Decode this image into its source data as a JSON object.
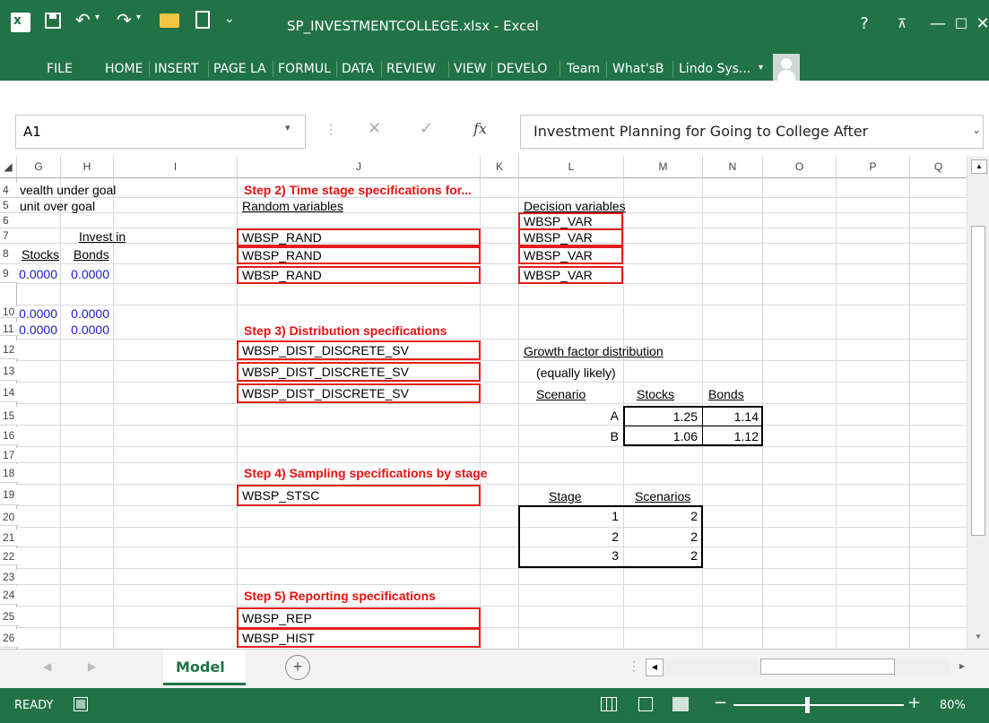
{
  "titlebar": {
    "app_icon": "excel-app-icon",
    "file_title": "SP_INVESTMENTCOLLEGE.xlsx - Excel",
    "help": "?",
    "ribbon_display": "restore-ribbon-icon",
    "minimize": "—",
    "maximize": "☐",
    "close": "✕"
  },
  "ribbon": {
    "tabs": [
      "FILE",
      "HOME",
      "INSERT",
      "PAGE LA",
      "FORMUL",
      "DATA",
      "REVIEW",
      "VIEW",
      "DEVELO",
      "Team",
      "What'sB",
      "Lindo Sys..."
    ]
  },
  "formula_bar": {
    "name_box": "A1",
    "formula": "Investment Planning for Going to College After",
    "fx": "fx"
  },
  "columns": [
    "G",
    "H",
    "I",
    "J",
    "K",
    "L",
    "M",
    "N",
    "O",
    "P",
    "Q"
  ],
  "rows": [
    "4",
    "5",
    "6",
    "7",
    "8",
    "9",
    "10",
    "11",
    "12",
    "13",
    "14",
    "15",
    "16",
    "17",
    "18",
    "19",
    "20",
    "21",
    "22",
    "23",
    "24",
    "25",
    "26"
  ],
  "cells": {
    "g4": "vealth under goal",
    "g5": "unit over goal",
    "g7": "Invest in",
    "g8": "Stocks",
    "h8": "Bonds",
    "g9": "0.0000",
    "h9": "0.0000",
    "g10": "0.0000",
    "h10": "0.0000",
    "g11": "0.0000",
    "h11": "0.0000",
    "j4": "Step 2) Time stage specifications for...",
    "j5": "Random variables",
    "l5": "Decision variables",
    "l6": "WBSP_VAR",
    "j7": "WBSP_RAND",
    "l7": "WBSP_VAR",
    "j8": "WBSP_RAND",
    "l8": "WBSP_VAR",
    "j9": "WBSP_RAND",
    "l9": "WBSP_VAR",
    "j11": "Step 3) Distribution specifications",
    "j12": "WBSP_DIST_DISCRETE_SV",
    "l12": "Growth factor distribution",
    "j13": "WBSP_DIST_DISCRETE_SV",
    "l13": "(equally likely)",
    "j14": "WBSP_DIST_DISCRETE_SV",
    "l14": "Scenario",
    "m14": "Stocks",
    "n14": "Bonds",
    "l15": "A",
    "m15": "1.25",
    "n15": "1.14",
    "l16": "B",
    "m16": "1.06",
    "n16": "1.12",
    "j18": "Step 4) Sampling specifications by stage",
    "j19": "WBSP_STSC",
    "l19": "Stage",
    "m19": "Scenarios",
    "l20": "1",
    "m20": "2",
    "l21": "2",
    "m21": "2",
    "l22": "3",
    "m22": "2",
    "j24": "Step 5) Reporting specifications",
    "j25": "WBSP_REP",
    "j26": "WBSP_HIST"
  },
  "sheets": {
    "active": "Model",
    "add": "+"
  },
  "status": {
    "ready": "READY",
    "zoom": "80%"
  }
}
